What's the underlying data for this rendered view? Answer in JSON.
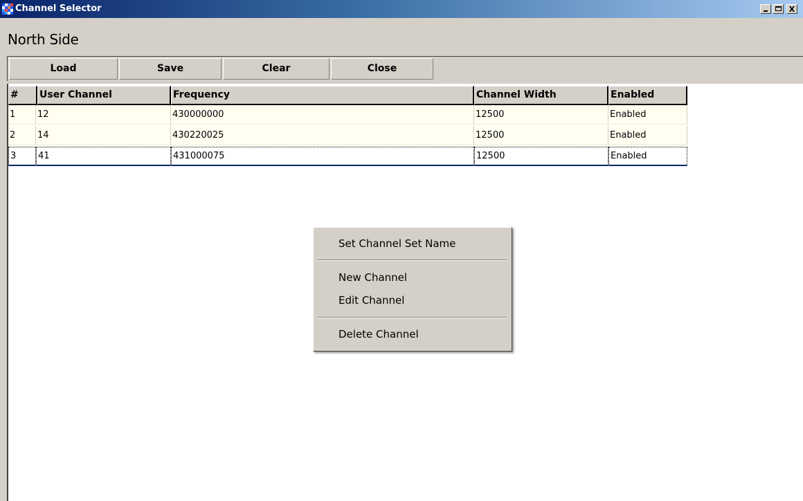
{
  "window": {
    "title": "Channel Selector",
    "controls": {
      "minimize": "_",
      "maximize": "□",
      "close": "X"
    }
  },
  "set_name": "North Side",
  "toolbar": {
    "load_label": "Load",
    "save_label": "Save",
    "clear_label": "Clear",
    "close_label": "Close"
  },
  "grid": {
    "columns": [
      "#",
      "User Channel",
      "Frequency",
      "Channel Width",
      "Enabled"
    ],
    "rows": [
      {
        "num": "1",
        "user_channel": "12",
        "frequency": "430000000",
        "channel_width": "12500",
        "enabled": "Enabled"
      },
      {
        "num": "2",
        "user_channel": "14",
        "frequency": "430220025",
        "channel_width": "12500",
        "enabled": "Enabled"
      },
      {
        "num": "3",
        "user_channel": "41",
        "frequency": "431000075",
        "channel_width": "12500",
        "enabled": "Enabled"
      }
    ],
    "selected_row": 3
  },
  "context_menu": {
    "set_name_label": "Set Channel Set Name",
    "new_channel_label": "New Channel",
    "edit_channel_label": "Edit Channel",
    "delete_channel_label": "Delete Channel"
  },
  "colors": {
    "title_gradient_start": "#0a246a",
    "title_gradient_end": "#a6caf0",
    "face": "#d4d0c8",
    "row_background": "#fffef0"
  },
  "icons": {
    "app": "grid-app-icon"
  }
}
